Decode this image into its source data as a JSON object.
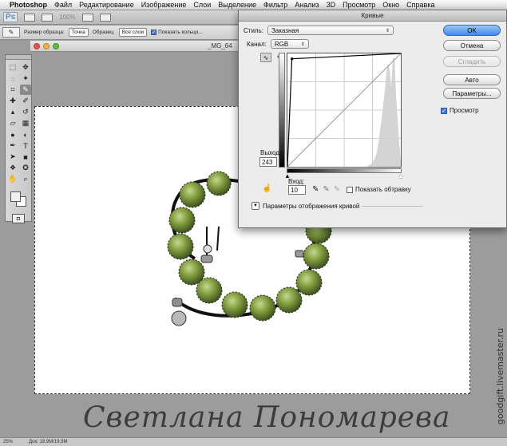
{
  "menubar": {
    "app": "Photoshop",
    "items": [
      "Файл",
      "Редактирование",
      "Изображение",
      "Слои",
      "Выделение",
      "Фильтр",
      "Анализ",
      "3D",
      "Просмотр",
      "Окно",
      "Справка"
    ]
  },
  "appbar": {
    "logo": "Ps",
    "zoom": "100%"
  },
  "options": {
    "size_label": "Размер образца:",
    "size_value": "Точка",
    "sample_label": "Образец:",
    "sample_value": "Все слои",
    "show_ring_label": "Показать кольцо..."
  },
  "document": {
    "title": "_MG_64",
    "watermark": "Светлана Пономарева",
    "side_url": "goodgift.livemaster.ru",
    "status_zoom": "25%",
    "status_doc": "Док: 19,9M/19,9M"
  },
  "curves": {
    "title": "Кривые",
    "style_label": "Стиль:",
    "style_value": "Заказная",
    "channel_label": "Канал:",
    "channel_value": "RGB",
    "output_label": "Выход:",
    "output_value": "243",
    "input_label": "Вход:",
    "input_value": "10",
    "show_clipping_label": "Показать обтравку",
    "curve_display_label": "Параметры отображения кривой",
    "buttons": {
      "ok": "OK",
      "cancel": "Отмена",
      "smooth": "Сгладить",
      "auto": "Авто",
      "options": "Параметры..."
    },
    "preview_label": "Просмотр",
    "preview_checked": true,
    "curve_point": {
      "input": 10,
      "output": 243
    }
  },
  "colors": {
    "accent": "#3f8ce6",
    "canvas": "#ffffff",
    "workspace": "#9c9c9c"
  }
}
